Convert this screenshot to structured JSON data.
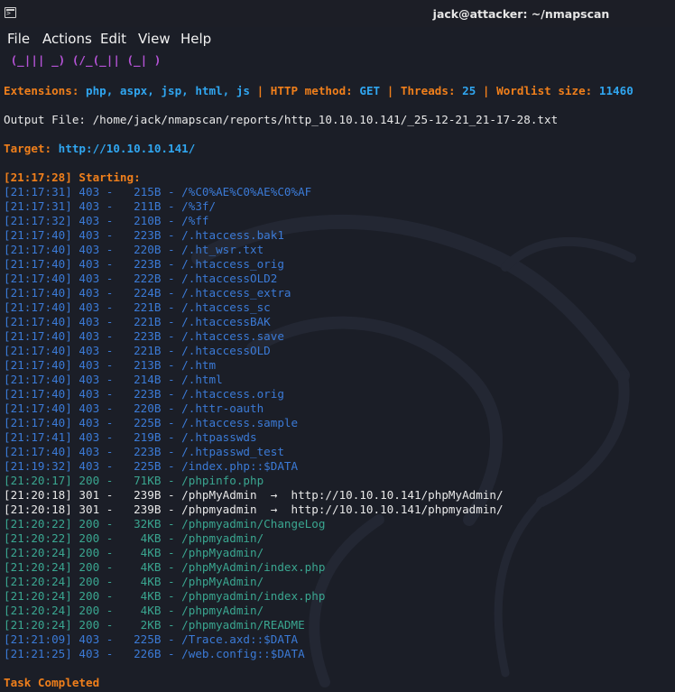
{
  "window": {
    "title": "jack@attacker: ~/nmapscan"
  },
  "menu": [
    "File",
    "Actions",
    "Edit",
    "View",
    "Help"
  ],
  "banner_tail": " (_||| _) (/_(_|| (_| )",
  "info": {
    "extensions_label": "Extensions:",
    "extensions_value": "php, aspx, jsp, html, js",
    "sep": "|",
    "method_label": "HTTP method:",
    "method_value": "GET",
    "threads_label": "Threads:",
    "threads_value": "25",
    "wordlist_label": "Wordlist size:",
    "wordlist_value": "11460"
  },
  "output_file": "Output File: /home/jack/nmapscan/reports/http_10.10.10.141/_25-12-21_21-17-28.txt",
  "target": {
    "label": "Target:",
    "value": "http://10.10.10.141/"
  },
  "start": {
    "time": "[21:17:28]",
    "text": "Starting:"
  },
  "rows": [
    {
      "time": "[21:17:31]",
      "status": "403",
      "size": "215B",
      "path": "/%C0%AE%C0%AE%C0%AF"
    },
    {
      "time": "[21:17:31]",
      "status": "403",
      "size": "211B",
      "path": "/%3f/"
    },
    {
      "time": "[21:17:32]",
      "status": "403",
      "size": "210B",
      "path": "/%ff"
    },
    {
      "time": "[21:17:40]",
      "status": "403",
      "size": "223B",
      "path": "/.htaccess.bak1"
    },
    {
      "time": "[21:17:40]",
      "status": "403",
      "size": "220B",
      "path": "/.ht_wsr.txt"
    },
    {
      "time": "[21:17:40]",
      "status": "403",
      "size": "223B",
      "path": "/.htaccess_orig"
    },
    {
      "time": "[21:17:40]",
      "status": "403",
      "size": "222B",
      "path": "/.htaccessOLD2"
    },
    {
      "time": "[21:17:40]",
      "status": "403",
      "size": "224B",
      "path": "/.htaccess_extra"
    },
    {
      "time": "[21:17:40]",
      "status": "403",
      "size": "221B",
      "path": "/.htaccess_sc"
    },
    {
      "time": "[21:17:40]",
      "status": "403",
      "size": "221B",
      "path": "/.htaccessBAK"
    },
    {
      "time": "[21:17:40]",
      "status": "403",
      "size": "223B",
      "path": "/.htaccess.save"
    },
    {
      "time": "[21:17:40]",
      "status": "403",
      "size": "221B",
      "path": "/.htaccessOLD"
    },
    {
      "time": "[21:17:40]",
      "status": "403",
      "size": "213B",
      "path": "/.htm"
    },
    {
      "time": "[21:17:40]",
      "status": "403",
      "size": "214B",
      "path": "/.html"
    },
    {
      "time": "[21:17:40]",
      "status": "403",
      "size": "223B",
      "path": "/.htaccess.orig"
    },
    {
      "time": "[21:17:40]",
      "status": "403",
      "size": "220B",
      "path": "/.httr-oauth"
    },
    {
      "time": "[21:17:40]",
      "status": "403",
      "size": "225B",
      "path": "/.htaccess.sample"
    },
    {
      "time": "[21:17:41]",
      "status": "403",
      "size": "219B",
      "path": "/.htpasswds"
    },
    {
      "time": "[21:17:40]",
      "status": "403",
      "size": "223B",
      "path": "/.htpasswd_test"
    },
    {
      "time": "[21:19:32]",
      "status": "403",
      "size": "225B",
      "path": "/index.php::$DATA"
    },
    {
      "time": "[21:20:17]",
      "status": "200",
      "size": "71KB",
      "path": "/phpinfo.php"
    },
    {
      "time": "[21:20:18]",
      "status": "301",
      "size": "239B",
      "path": "/phpMyAdmin",
      "redirect": "http://10.10.10.141/phpMyAdmin/"
    },
    {
      "time": "[21:20:18]",
      "status": "301",
      "size": "239B",
      "path": "/phpmyadmin",
      "redirect": "http://10.10.10.141/phpmyadmin/"
    },
    {
      "time": "[21:20:22]",
      "status": "200",
      "size": "32KB",
      "path": "/phpmyadmin/ChangeLog"
    },
    {
      "time": "[21:20:22]",
      "status": "200",
      "size": "4KB",
      "path": "/phpmyadmin/"
    },
    {
      "time": "[21:20:24]",
      "status": "200",
      "size": "4KB",
      "path": "/phpMyadmin/"
    },
    {
      "time": "[21:20:24]",
      "status": "200",
      "size": "4KB",
      "path": "/phpMyAdmin/index.php"
    },
    {
      "time": "[21:20:24]",
      "status": "200",
      "size": "4KB",
      "path": "/phpMyAdmin/"
    },
    {
      "time": "[21:20:24]",
      "status": "200",
      "size": "4KB",
      "path": "/phpmyadmin/index.php"
    },
    {
      "time": "[21:20:24]",
      "status": "200",
      "size": "4KB",
      "path": "/phpmyAdmin/"
    },
    {
      "time": "[21:20:24]",
      "status": "200",
      "size": "2KB",
      "path": "/phpmyadmin/README"
    },
    {
      "time": "[21:21:09]",
      "status": "403",
      "size": "225B",
      "path": "/Trace.axd::$DATA"
    },
    {
      "time": "[21:21:25]",
      "status": "403",
      "size": "226B",
      "path": "/web.config::$DATA"
    }
  ],
  "completed": "Task Completed",
  "colors": {
    "background": "#1b1e27",
    "orange": "#f07f1b",
    "blue": "#30a6f0",
    "row_blue": "#3b7ad6",
    "row_green": "#3aa690",
    "purple": "#b553d6"
  }
}
